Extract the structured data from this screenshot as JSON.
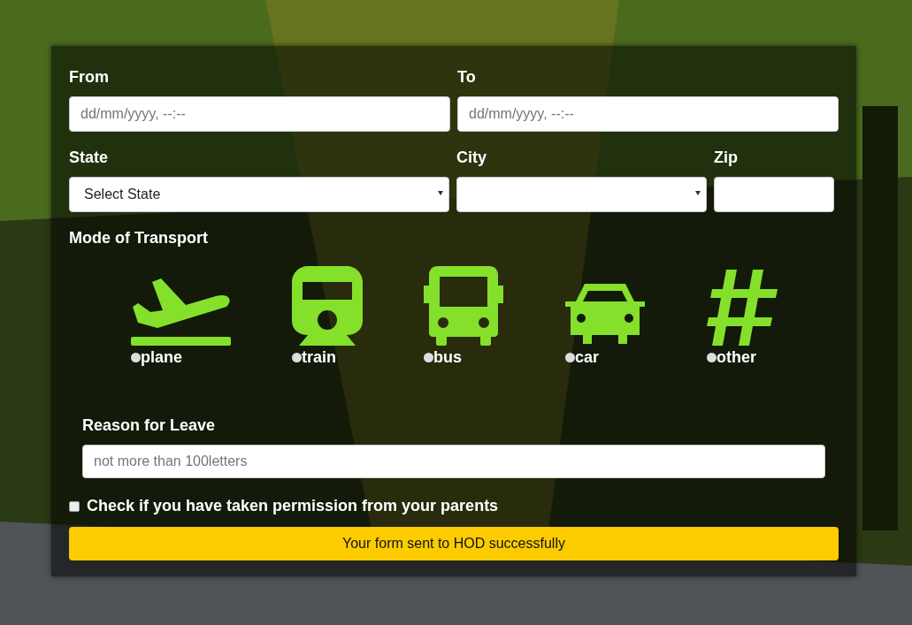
{
  "form": {
    "from": {
      "label": "From",
      "placeholder": "dd/mm/yyyy, --:--"
    },
    "to": {
      "label": "To",
      "placeholder": "dd/mm/yyyy, --:--"
    },
    "state": {
      "label": "State",
      "value": "Select State"
    },
    "city": {
      "label": "City"
    },
    "zip": {
      "label": "Zip"
    },
    "transport": {
      "label": "Mode of Transport",
      "options": [
        {
          "kind": "plane",
          "label": "plane",
          "selected": false
        },
        {
          "kind": "train",
          "label": "train",
          "selected": false
        },
        {
          "kind": "bus",
          "label": "bus",
          "selected": false
        },
        {
          "kind": "car",
          "label": "car",
          "selected": false
        },
        {
          "kind": "other",
          "label": "other",
          "selected": false
        }
      ]
    },
    "reason": {
      "label": "Reason for Leave",
      "placeholder": "not more than 100letters"
    },
    "permission": {
      "label": "Check if you have taken permission from your parents",
      "checked": false
    },
    "message": "Your form sent to HOD successfully"
  }
}
